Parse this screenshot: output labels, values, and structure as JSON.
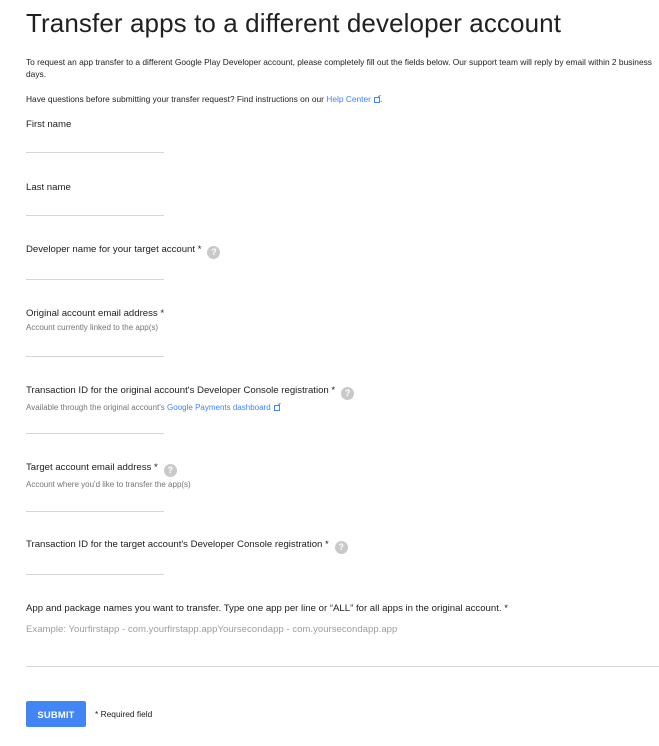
{
  "page": {
    "title": "Transfer apps to a different developer account",
    "intro": "To request an app transfer to a different Google Play Developer account, please completely fill out the fields below. Our support team will reply by email within 2 business days.",
    "questions_prefix": "Have questions before submitting your transfer request? Find instructions on our",
    "help_center_link": "Help Center",
    "questions_suffix": "."
  },
  "fields": {
    "first_name": {
      "label": "First name"
    },
    "last_name": {
      "label": "Last name"
    },
    "developer_name": {
      "label": "Developer name for your target account *",
      "icon": "help-icon"
    },
    "original_email": {
      "label": "Original account email address *",
      "sub": "Account currently linked to the app(s)"
    },
    "original_txn": {
      "label": "Transaction ID for the original account's Developer Console registration *",
      "icon": "help-icon",
      "sub_prefix": "Available through the original account's",
      "sub_link": "Google Payments dashboard"
    },
    "target_email": {
      "label": "Target account email address *",
      "icon": "help-icon",
      "sub": "Account where you'd like to transfer the app(s)"
    },
    "target_txn": {
      "label": "Transaction ID for the target account's Developer Console registration *",
      "icon": "help-icon"
    },
    "apps": {
      "label": "App and package names you want to transfer. Type one app per line or “ALL” for all apps in the original account. *",
      "placeholder": "Example: Yourfirstapp - com.yourfirstapp.appYoursecondapp - com.yoursecondapp.app"
    }
  },
  "footer": {
    "submit_label": "SUBMIT",
    "required_note": "* Required field"
  }
}
